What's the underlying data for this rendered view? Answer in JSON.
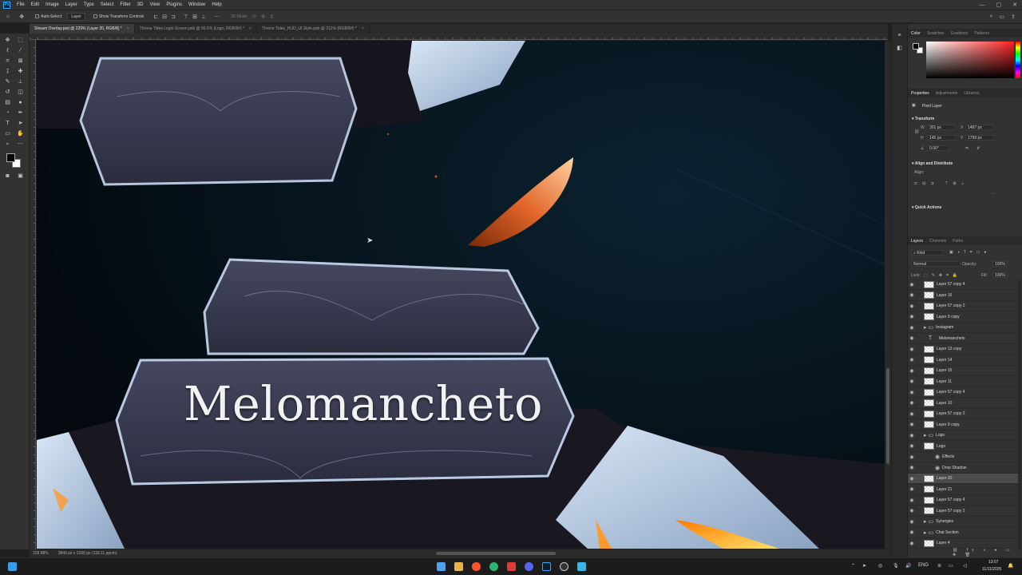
{
  "menu": [
    "File",
    "Edit",
    "Image",
    "Layer",
    "Type",
    "Select",
    "Filter",
    "3D",
    "View",
    "Plugins",
    "Window",
    "Help"
  ],
  "options": {
    "auto_select": "Auto-Select:",
    "layer_select": "Layer",
    "transform_controls": "Show Transform Controls",
    "mode_3d": "3D Mode:"
  },
  "tabs": [
    {
      "label": "Stream Overlay.psd @ 229% (Layer 20, RGB/8) *",
      "close": "×"
    },
    {
      "label": "Throne Tides Login Screen.psb @ 56.6% (Logo, RGB/8#) *",
      "close": "×"
    },
    {
      "label": "Throne Tides_HUD_UI Style.psb @ 212% (RGB/8#) *",
      "close": "×"
    }
  ],
  "canvas": {
    "overlay_text": "Melomancheto"
  },
  "status": {
    "zoom": "228.88%",
    "doc_info": "3840 px x 2160 px (118.11 ppcm)"
  },
  "color_panel": {
    "tabs": [
      "Color",
      "Swatches",
      "Gradients",
      "Patterns"
    ],
    "foreground": "#000000",
    "background": "#ffffff",
    "picker_hue": "#ff2020"
  },
  "properties_panel": {
    "tabs": [
      "Properties",
      "Adjustments",
      "Libraries"
    ],
    "type": "Pixel Layer",
    "transform_title": "Transform",
    "w_label": "W",
    "w_value": "301 px",
    "h_label": "H",
    "h_value": "145 px",
    "x_label": "X",
    "x_value": "1487 px",
    "y_label": "Y",
    "y_value": "1799 px",
    "angle": "0.00°",
    "align_title": "Align and Distribute",
    "align_label": "Align:",
    "quick_title": "Quick Actions"
  },
  "layers_panel": {
    "tabs": [
      "Layers",
      "Channels",
      "Paths"
    ],
    "kind": "Kind",
    "blend": "Normal",
    "opacity_label": "Opacity:",
    "opacity": "100%",
    "lock_label": "Lock:",
    "fill_label": "Fill:",
    "fill": "100%",
    "rows": [
      {
        "name": "Layer 57 copy 4",
        "kind": "layer"
      },
      {
        "name": "Layer 16",
        "kind": "layer"
      },
      {
        "name": "Layer 57 copy 2",
        "kind": "layer"
      },
      {
        "name": "Layer 9 copy",
        "kind": "layer"
      },
      {
        "name": "Instagram",
        "kind": "folder"
      },
      {
        "name": "Melomanchelo",
        "kind": "text"
      },
      {
        "name": "Layer 13 copy",
        "kind": "layer"
      },
      {
        "name": "Layer 14",
        "kind": "layer"
      },
      {
        "name": "Layer 15",
        "kind": "layer"
      },
      {
        "name": "Layer 11",
        "kind": "layer"
      },
      {
        "name": "Layer 57 copy 4",
        "kind": "layer"
      },
      {
        "name": "Layer 10",
        "kind": "layer"
      },
      {
        "name": "Layer 57 copy 2",
        "kind": "layer"
      },
      {
        "name": "Layer 9 copy",
        "kind": "layer"
      },
      {
        "name": "Logo",
        "kind": "folder"
      },
      {
        "name": "Logo",
        "kind": "smart"
      },
      {
        "name": "Effects",
        "kind": "effect"
      },
      {
        "name": "Drop Shadow",
        "kind": "effect"
      },
      {
        "name": "Layer 20",
        "kind": "layer",
        "selected": true
      },
      {
        "name": "Layer 21",
        "kind": "layer"
      },
      {
        "name": "Layer 57 copy 4",
        "kind": "layer"
      },
      {
        "name": "Layer 57 copy 2",
        "kind": "layer"
      },
      {
        "name": "Synergies",
        "kind": "folder"
      },
      {
        "name": "Chat Section",
        "kind": "folder"
      },
      {
        "name": "Layer 4",
        "kind": "layer"
      }
    ]
  },
  "taskbar": {
    "lang": "ENG",
    "time": "13:07",
    "date": "11/11/2025"
  }
}
